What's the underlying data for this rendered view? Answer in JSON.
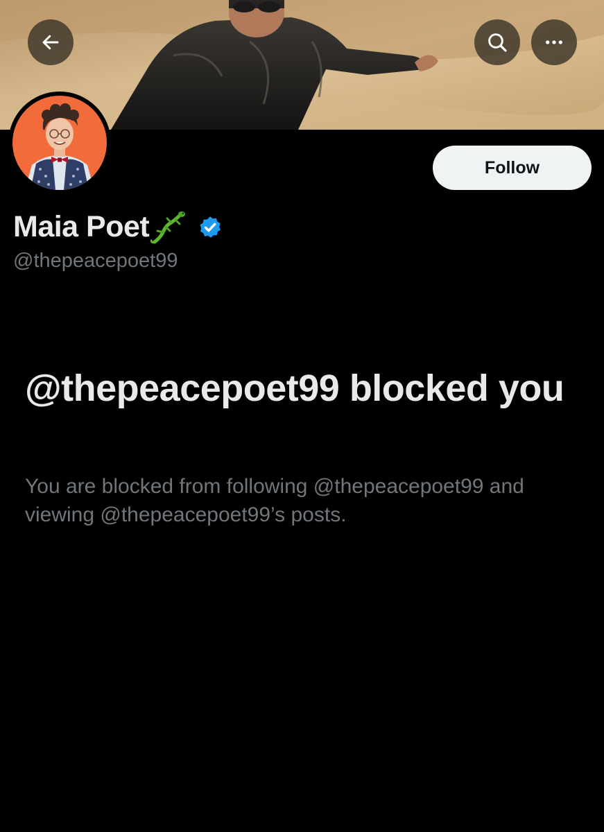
{
  "profile": {
    "display_name": "Maia Poet",
    "handle": "@thepeacepoet99",
    "name_emoji_icon": "lizard-icon",
    "verified_badge_icon": "verified-badge-icon"
  },
  "header": {
    "back_icon": "arrow-left-icon",
    "search_icon": "search-icon",
    "more_icon": "more-horizontal-icon"
  },
  "actions": {
    "follow_label": "Follow"
  },
  "blocked": {
    "title": "@thepeacepoet99 blocked you",
    "description": "You are blocked from following @thepeacepoet99 and viewing @thepeacepoet99’s posts."
  },
  "colors": {
    "background": "#000000",
    "primary_text": "#e7e9ea",
    "secondary_text": "#71767b",
    "follow_button_bg": "#eff3f4",
    "verified_blue": "#1d9bf0",
    "avatar_bg": "#f26b3a"
  }
}
